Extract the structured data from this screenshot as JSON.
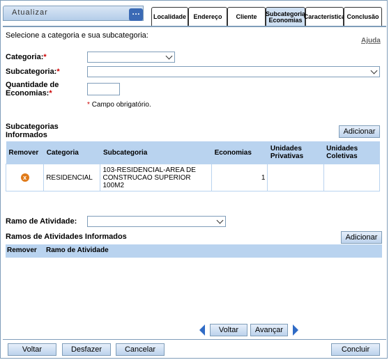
{
  "header": {
    "title": "Atualizar",
    "tabs": [
      {
        "label": "Localidade",
        "active": false
      },
      {
        "label": "Endereço",
        "active": false
      },
      {
        "label": "Cliente",
        "active": false
      },
      {
        "label": "Subcategoria Economias",
        "active": true
      },
      {
        "label": "Característica",
        "active": false
      },
      {
        "label": "Conclusão",
        "active": false
      }
    ]
  },
  "instructions": "Selecione a categoria e sua subcategoria:",
  "help_link": "Ajuda",
  "form": {
    "categoria_label": "Categoria:",
    "subcategoria_label": "Subcategoria:",
    "quantidade_label_1": "Quantidade de",
    "quantidade_label_2": "Economias:",
    "required_mark": "*",
    "required_note": "Campo obrigatório."
  },
  "subcategorias": {
    "title_1": "Subcategorias",
    "title_2": "Informados",
    "add_button": "Adicionar",
    "columns": [
      "Remover",
      "Categoria",
      "Subcategoria",
      "Economias",
      "Unidades Privativas",
      "Unidades Coletivas"
    ],
    "rows": [
      {
        "categoria": "RESIDENCIAL",
        "subcategoria": "103-RESIDENCIAL-AREA DE CONSTRUCAO SUPERIOR 100M2",
        "economias": "1",
        "privativas": "",
        "coletivas": ""
      }
    ]
  },
  "ramo": {
    "label": "Ramo de Atividade:",
    "list_title": "Ramos de Atividades Informados",
    "add_button": "Adicionar",
    "columns": [
      "Remover",
      "Ramo de Atividade"
    ]
  },
  "nav": {
    "back": "Voltar",
    "next": "Avançar"
  },
  "footer": {
    "voltar": "Voltar",
    "desfazer": "Desfazer",
    "cancelar": "Cancelar",
    "concluir": "Concluir"
  },
  "colors": {
    "accent": "#b9d3ef",
    "border": "#7f9db9",
    "required": "#cc0000",
    "nav_arrow": "#2f6bc6",
    "remove_icon": "#e07b1a"
  }
}
